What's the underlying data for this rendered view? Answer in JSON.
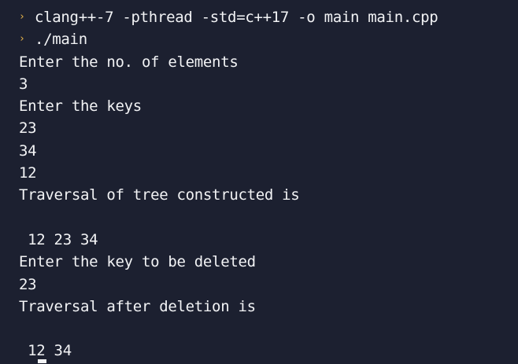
{
  "terminal": {
    "prompt_symbol": "›",
    "commands": [
      "clang++-7 -pthread -std=c++17 -o main main.cpp",
      "./main"
    ],
    "output": [
      "Enter the no. of elements",
      "3",
      "Enter the keys",
      "23",
      "34",
      "12",
      "Traversal of tree constructed is",
      "",
      " 12 23 34",
      "Enter the key to be deleted",
      "23",
      "Traversal after deletion is",
      "",
      " 12 34"
    ]
  },
  "colors": {
    "background": "#1c2030",
    "text": "#f2f3f5",
    "prompt": "#e8b54a"
  }
}
